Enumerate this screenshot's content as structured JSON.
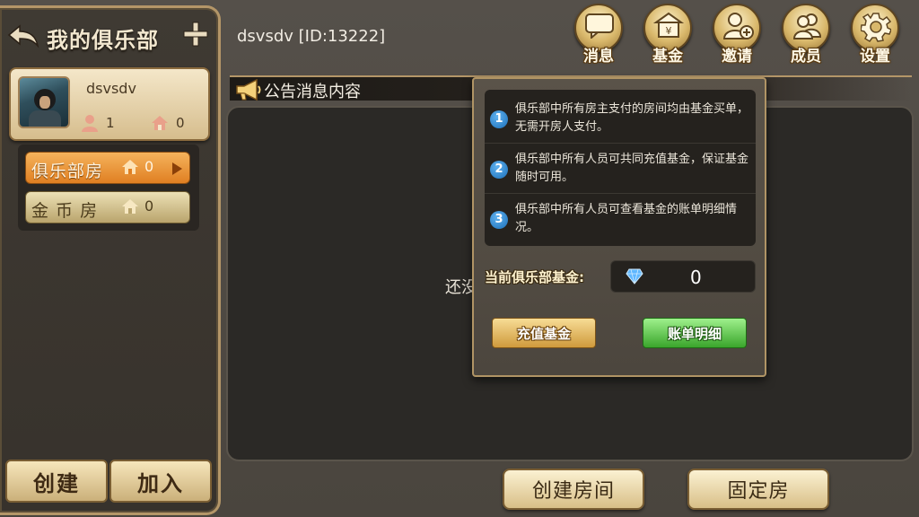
{
  "sidebar": {
    "title": "我的俱乐部",
    "club": {
      "name": "dsvsdv",
      "members": "1",
      "rooms": "0"
    },
    "room_types": [
      {
        "label": "俱乐部房",
        "count": "0"
      },
      {
        "label": "金 币 房",
        "count": "0"
      }
    ],
    "create_label": "创建",
    "join_label": "加入"
  },
  "header": {
    "title": "dsvsdv [ID:13222]",
    "icons": [
      {
        "label": "消息",
        "icon": "message-icon"
      },
      {
        "label": "基金",
        "icon": "fund-icon"
      },
      {
        "label": "邀请",
        "icon": "invite-icon"
      },
      {
        "label": "成员",
        "icon": "members-icon"
      },
      {
        "label": "设置",
        "icon": "settings-icon"
      }
    ]
  },
  "notice": {
    "title": "公告消息内容",
    "empty_text": "还没"
  },
  "actions": {
    "create_room": "创建房间",
    "fixed_room": "固定房"
  },
  "fund_popup": {
    "info": [
      {
        "num": "1",
        "text": "俱乐部中所有房主支付的房间均由基金买单，无需开房人支付。"
      },
      {
        "num": "2",
        "text": "俱乐部中所有人员可共同充值基金，保证基金随时可用。"
      },
      {
        "num": "3",
        "text": "俱乐部中所有人员可查看基金的账单明细情况。"
      }
    ],
    "fund_label": "当前俱乐部基金:",
    "fund_value": "0",
    "recharge_label": "充值基金",
    "bill_label": "账单明细"
  }
}
